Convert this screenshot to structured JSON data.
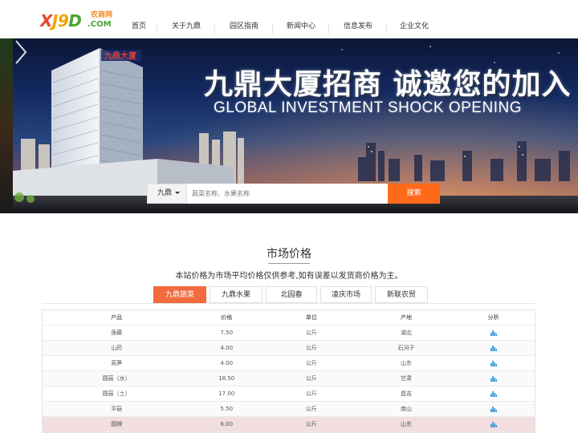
{
  "logo": {
    "letters": [
      "X",
      "J",
      "9",
      "D"
    ],
    "suffix": ".COM",
    "tagline": "农商网"
  },
  "nav": {
    "items": [
      {
        "label": "首页"
      },
      {
        "label": "关于九鼎"
      },
      {
        "label": "园区指南"
      },
      {
        "label": "新闻中心"
      },
      {
        "label": "信息发布"
      },
      {
        "label": "企业文化"
      }
    ]
  },
  "banner": {
    "title_cn": "九鼎大厦招商  诚邀您的加入",
    "title_en": "GLOBAL INVESTMENT SHOCK OPENING",
    "building_sign": "九鼎大厦"
  },
  "search": {
    "scope_label": "九鼎",
    "placeholder": "蔬菜名称、水果名称",
    "button_label": "搜索"
  },
  "market": {
    "title": "市场价格",
    "subtitle": "本站价格为市场平均价格仅供参考,如有误差以发货商价格为主。",
    "tabs": [
      {
        "label": "九鼎蔬菜",
        "active": true
      },
      {
        "label": "九鼎水果",
        "active": false
      },
      {
        "label": "北园春",
        "active": false
      },
      {
        "label": "凌庆市场",
        "active": false
      },
      {
        "label": "新联农贸",
        "active": false
      }
    ],
    "columns": [
      "产品",
      "价格",
      "单位",
      "产地",
      "分析"
    ],
    "rows": [
      {
        "product": "莲藕",
        "price": "7.50",
        "unit": "公斤",
        "origin": "湖北"
      },
      {
        "product": "山药",
        "price": "4.00",
        "unit": "公斤",
        "origin": "石河子"
      },
      {
        "product": "莴笋",
        "price": "4.00",
        "unit": "公斤",
        "origin": "山东"
      },
      {
        "product": "圆菇（水）",
        "price": "18.50",
        "unit": "公斤",
        "origin": "甘肃"
      },
      {
        "product": "圆菇（土）",
        "price": "17.00",
        "unit": "公斤",
        "origin": "昌吉"
      },
      {
        "product": "平菇",
        "price": "5.50",
        "unit": "公斤",
        "origin": "南山"
      },
      {
        "product": "圆辣",
        "price": "6.00",
        "unit": "公斤",
        "origin": "山东"
      }
    ],
    "highlight_row": 6,
    "analysis_icon": "bar-chart-icon"
  },
  "colors": {
    "accent": "#ff6a1a",
    "tab_active": "#f26a3d",
    "analysis_icon": "#2a8fd0"
  }
}
